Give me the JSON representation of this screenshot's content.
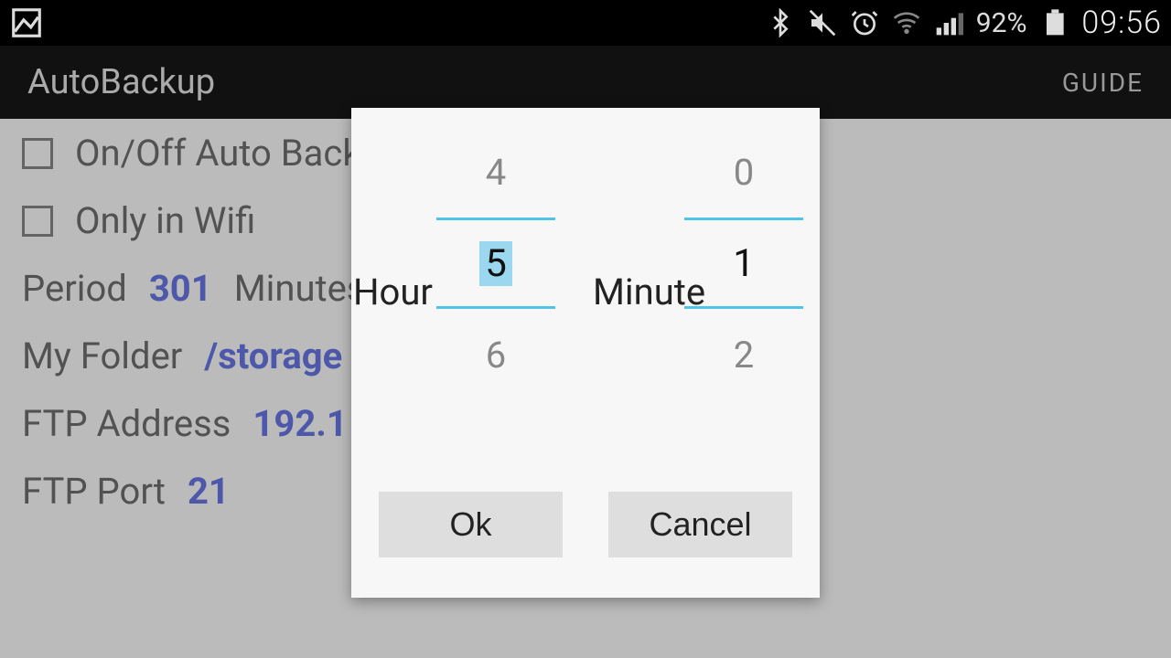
{
  "status": {
    "battery_pct": "92%",
    "clock": "09:56"
  },
  "app": {
    "title": "AutoBackup",
    "guide": "GUIDE"
  },
  "settings": {
    "onoff_label": "On/Off Auto Backup",
    "wifi_label": "Only in Wifi",
    "period_label": "Period",
    "period_value": "301",
    "period_unit": "Minutes",
    "folder_label": "My Folder",
    "folder_value": "/storage",
    "ftp_addr_label": "FTP Address",
    "ftp_addr_value": "192.1",
    "ftp_port_label": "FTP Port",
    "ftp_port_value": "21"
  },
  "dialog": {
    "hour_label": "Hour",
    "minute_label": "Minute",
    "hour_prev": "4",
    "hour_sel": "5",
    "hour_next": "6",
    "minute_prev": "0",
    "minute_sel": "1",
    "minute_next": "2",
    "ok": "Ok",
    "cancel": "Cancel"
  }
}
